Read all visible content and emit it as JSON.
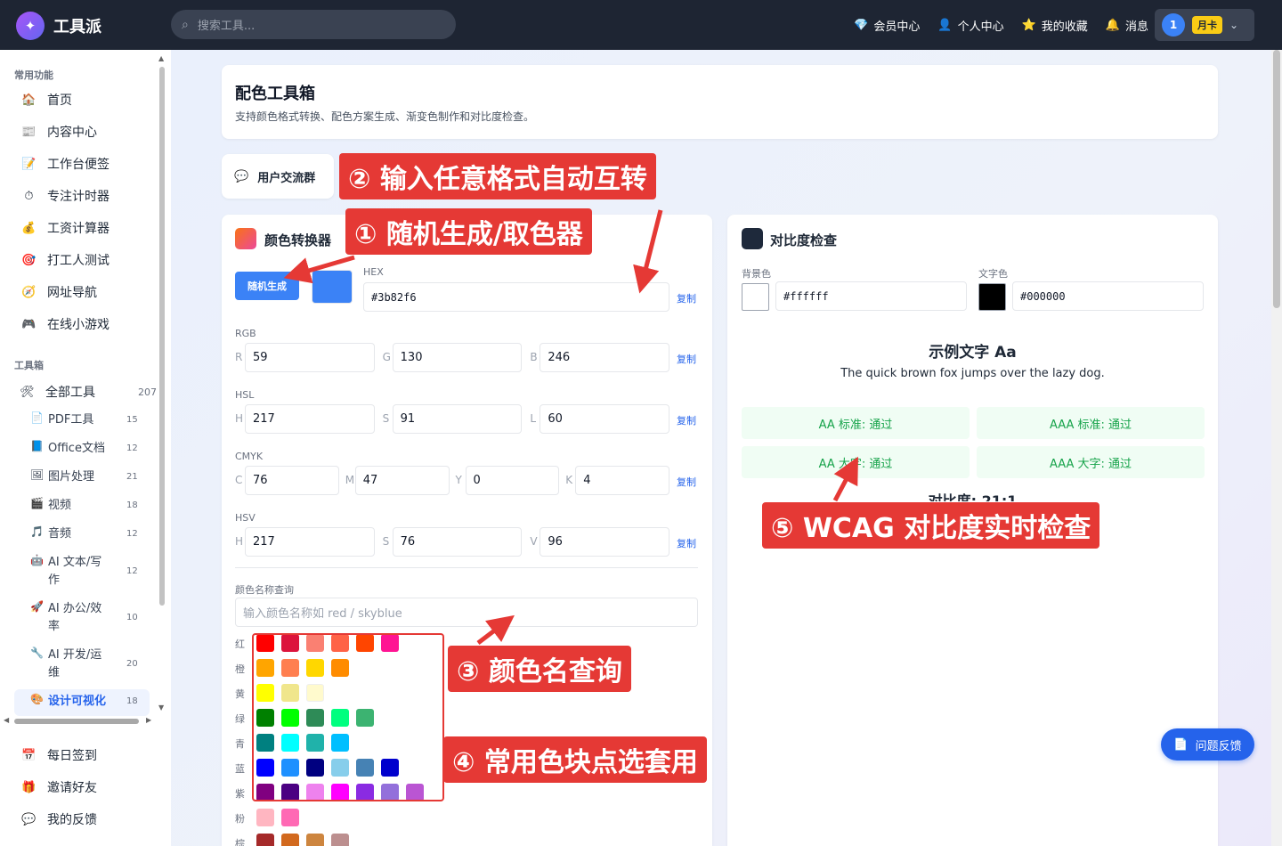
{
  "topbar": {
    "brand": "工具派",
    "search_placeholder": "搜索工具...",
    "links": [
      {
        "icon": "💎",
        "icon_name": "diamond-icon",
        "label": "会员中心"
      },
      {
        "icon": "👤",
        "icon_name": "user-icon",
        "label": "个人中心"
      },
      {
        "icon": "⭐",
        "icon_name": "star-icon",
        "label": "我的收藏"
      },
      {
        "icon": "🔔",
        "icon_name": "bell-icon",
        "label": "消息"
      }
    ],
    "user": {
      "avatar": "1",
      "badge": "月卡"
    }
  },
  "sidebar": {
    "section_common": "常用功能",
    "common": [
      {
        "icon": "🏠",
        "label": "首页"
      },
      {
        "icon": "📰",
        "label": "内容中心"
      },
      {
        "icon": "📝",
        "label": "工作台便签"
      },
      {
        "icon": "⏱",
        "label": "专注计时器"
      },
      {
        "icon": "💰",
        "label": "工资计算器"
      },
      {
        "icon": "🎯",
        "label": "打工人测试"
      },
      {
        "icon": "🧭",
        "label": "网址导航"
      },
      {
        "icon": "🎮",
        "label": "在线小游戏"
      }
    ],
    "section_tools": "工具箱",
    "all_tools": {
      "icon": "🛠",
      "label": "全部工具",
      "count": "207"
    },
    "categories": [
      {
        "icon": "📄",
        "label": "PDF工具",
        "count": "15"
      },
      {
        "icon": "📘",
        "label": "Office文档",
        "count": "12"
      },
      {
        "icon": "🖼",
        "label": "图片处理",
        "count": "21"
      },
      {
        "icon": "🎬",
        "label": "视频",
        "count": "18"
      },
      {
        "icon": "🎵",
        "label": "音频",
        "count": "12"
      },
      {
        "icon": "🤖",
        "label": "AI 文本/写作",
        "count": "12"
      },
      {
        "icon": "🚀",
        "label": "AI 办公/效率",
        "count": "10"
      },
      {
        "icon": "🔧",
        "label": "AI 开发/运维",
        "count": "20"
      },
      {
        "icon": "🎨",
        "label": "设计可视化",
        "count": "18"
      }
    ],
    "bottom": [
      {
        "icon": "📅",
        "label": "每日签到"
      },
      {
        "icon": "🎁",
        "label": "邀请好友"
      },
      {
        "icon": "💬",
        "label": "我的反馈"
      }
    ]
  },
  "header": {
    "title": "配色工具箱",
    "subtitle": "支持颜色格式转换、配色方案生成、渐变色制作和对比度检查。"
  },
  "group_button": "用户交流群",
  "converter": {
    "title": "颜色转换器",
    "random_button": "随机生成",
    "current_color": "#3b82f6",
    "hex_label": "HEX",
    "hex_value": "#3b82f6",
    "copy": "复制",
    "rgb_label": "RGB",
    "rgb": [
      {
        "p": "R",
        "v": "59"
      },
      {
        "p": "G",
        "v": "130"
      },
      {
        "p": "B",
        "v": "246"
      }
    ],
    "hsl_label": "HSL",
    "hsl": [
      {
        "p": "H",
        "v": "217"
      },
      {
        "p": "S",
        "v": "91"
      },
      {
        "p": "L",
        "v": "60"
      }
    ],
    "cmyk_label": "CMYK",
    "cmyk": [
      {
        "p": "C",
        "v": "76"
      },
      {
        "p": "M",
        "v": "47"
      },
      {
        "p": "Y",
        "v": "0"
      },
      {
        "p": "K",
        "v": "4"
      }
    ],
    "hsv_label": "HSV",
    "hsv": [
      {
        "p": "H",
        "v": "217"
      },
      {
        "p": "S",
        "v": "76"
      },
      {
        "p": "V",
        "v": "96"
      }
    ],
    "name_query_label": "颜色名称查询",
    "name_query_placeholder": "输入颜色名称如 red / skyblue",
    "palette": [
      {
        "label": "红",
        "colors": [
          "#ff0000",
          "#dc143c",
          "#fa8072",
          "#ff6347",
          "#ff4500",
          "#ff1493"
        ]
      },
      {
        "label": "橙",
        "colors": [
          "#ffa500",
          "#ff7f50",
          "#ffd700",
          "#ff8c00"
        ]
      },
      {
        "label": "黄",
        "colors": [
          "#ffff00",
          "#f0e68c",
          "#fffacd"
        ]
      },
      {
        "label": "绿",
        "colors": [
          "#008000",
          "#00ff00",
          "#2e8b57",
          "#00ff7f",
          "#3cb371"
        ]
      },
      {
        "label": "青",
        "colors": [
          "#008080",
          "#00ffff",
          "#20b2aa",
          "#00bfff"
        ]
      },
      {
        "label": "蓝",
        "colors": [
          "#0000ff",
          "#1e90ff",
          "#000080",
          "#87ceeb",
          "#4682b4",
          "#0000cd"
        ]
      },
      {
        "label": "紫",
        "colors": [
          "#800080",
          "#4b0082",
          "#ee82ee",
          "#ff00ff",
          "#8a2be2",
          "#9370db",
          "#ba55d3"
        ]
      },
      {
        "label": "粉",
        "colors": [
          "#ffb6c1",
          "#ff69b4"
        ]
      },
      {
        "label": "棕",
        "colors": [
          "#a52a2a",
          "#d2691e",
          "#cd853f",
          "#bc8f8f"
        ]
      }
    ]
  },
  "contrast": {
    "title": "对比度检查",
    "bg_label": "背景色",
    "bg_value": "#ffffff",
    "bg_color": "#ffffff",
    "fg_label": "文字色",
    "fg_value": "#000000",
    "fg_color": "#000000",
    "sample_title": "示例文字 Aa",
    "sample_text": "The quick brown fox jumps over the lazy dog.",
    "results": [
      "AA 标准: 通过",
      "AAA 标准: 通过",
      "AA 大字: 通过",
      "AAA 大字: 通过"
    ],
    "ratio_text": "对比度: 21:1"
  },
  "annotations": {
    "a1": "① 随机生成/取色器",
    "a2": "② 输入任意格式自动互转",
    "a3": "③ 颜色名查询",
    "a4": "④ 常用色块点选套用",
    "a5": "⑤ WCAG 对比度实时检查"
  },
  "feedback_button": "问题反馈"
}
